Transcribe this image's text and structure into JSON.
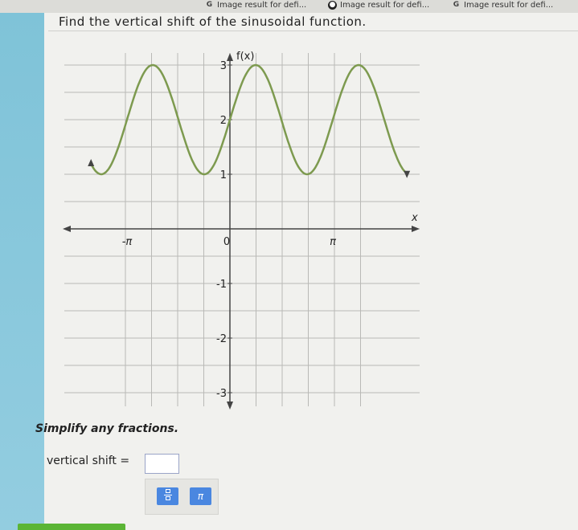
{
  "bookmarks": [
    {
      "icon": "google-icon",
      "label": "Image result for defi..."
    },
    {
      "icon": "dark-circle-icon",
      "label": "Image result for defi..."
    },
    {
      "icon": "google-icon",
      "label": "Image result for defi..."
    }
  ],
  "question": "Find the vertical shift of the sinusoidal function.",
  "instructions": "Simplify any fractions.",
  "answer": {
    "label": "vertical shift =",
    "value": ""
  },
  "toolbar": {
    "pi_label": "π"
  },
  "chart_data": {
    "type": "line",
    "function": "f(x) = 2 + sin(2x)",
    "ylabel": "f(x)",
    "xlabel": "x",
    "x_ticks": [
      {
        "value": -3.14159,
        "label": "-π"
      },
      {
        "value": 0,
        "label": "0"
      },
      {
        "value": 3.14159,
        "label": "π"
      }
    ],
    "y_ticks": [
      1,
      2,
      3,
      -1,
      -2,
      -3
    ],
    "xlim": [
      -6.28,
      7.85
    ],
    "ylim": [
      -3.3,
      3.3
    ],
    "vertical_shift": 2,
    "amplitude": 1,
    "period": 3.14159,
    "max": 3,
    "min": 1,
    "grid": true
  }
}
